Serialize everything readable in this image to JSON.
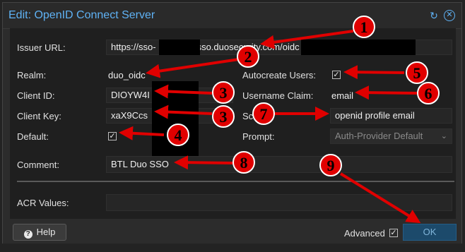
{
  "dialog": {
    "title": "Edit: OpenID Connect Server",
    "reset_icon": "reset-icon",
    "close_icon": "close-icon"
  },
  "form": {
    "issuer_url": {
      "label": "Issuer URL:",
      "value_start": "https://sso-",
      "value_mid": "sso.duosecurity.com/oidc",
      "value_end": ")"
    },
    "realm": {
      "label": "Realm:",
      "value": "duo_oidc"
    },
    "client_id": {
      "label": "Client ID:",
      "value": "DIOYW4I"
    },
    "client_key": {
      "label": "Client Key:",
      "value": "xaX9Ccs"
    },
    "default": {
      "label": "Default:",
      "checked": true
    },
    "comment": {
      "label": "Comment:",
      "value": "BTL Duo SSO"
    },
    "acr_values": {
      "label": "ACR Values:",
      "value": ""
    },
    "autocreate_users": {
      "label": "Autocreate Users:",
      "checked": true
    },
    "username_claim": {
      "label": "Username Claim:",
      "value": "email"
    },
    "scopes": {
      "label": "Sc",
      "value": "openid profile email"
    },
    "prompt": {
      "label": "Prompt:",
      "value": "Auth-Provider Default"
    }
  },
  "footer": {
    "help_label": "Help",
    "advanced_label": "Advanced",
    "advanced_checked": true,
    "ok_label": "OK"
  },
  "annotations": {
    "color": "#e00000",
    "badges": [
      "1",
      "2",
      "3",
      "3",
      "4",
      "5",
      "6",
      "7",
      "8",
      "9"
    ]
  }
}
